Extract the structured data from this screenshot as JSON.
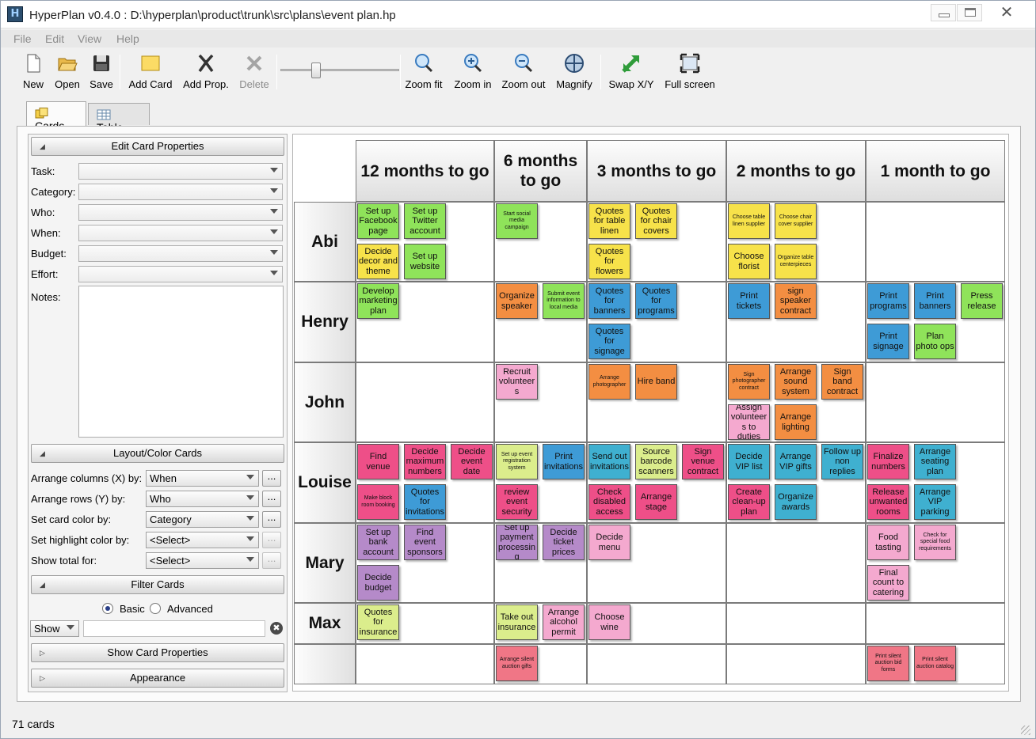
{
  "window": {
    "title": "HyperPlan v0.4.0 : D:\\hyperplan\\product\\trunk\\src\\plans\\event plan.hp"
  },
  "menu": [
    "File",
    "Edit",
    "View",
    "Help"
  ],
  "toolbar": {
    "new": "New",
    "open": "Open",
    "save": "Save",
    "add_card": "Add Card",
    "add_prop": "Add Prop.",
    "delete": "Delete",
    "zoom_fit": "Zoom fit",
    "zoom_in": "Zoom in",
    "zoom_out": "Zoom out",
    "magnify": "Magnify",
    "swap": "Swap X/Y",
    "full_screen": "Full screen"
  },
  "tabs": {
    "cards": "Cards",
    "table": "Table"
  },
  "edit_panel": {
    "header": "Edit Card Properties",
    "task": "Task:",
    "category": "Category:",
    "who": "Who:",
    "when": "When:",
    "budget": "Budget:",
    "effort": "Effort:",
    "notes": "Notes:"
  },
  "layout_panel": {
    "header": "Layout/Color Cards",
    "arrange_x_label": "Arrange columns (X) by:",
    "arrange_x_value": "When",
    "arrange_y_label": "Arrange rows (Y) by:",
    "arrange_y_value": "Who",
    "card_color_label": "Set card color by:",
    "card_color_value": "Category",
    "highlight_label": "Set highlight color by:",
    "highlight_value": "<Select>",
    "total_label": "Show total for:",
    "total_value": "<Select>",
    "dots": "..."
  },
  "filter_panel": {
    "header": "Filter Cards",
    "basic": "Basic",
    "advanced": "Advanced",
    "show": "Show",
    "clear": "✖"
  },
  "show_props_header": "Show Card Properties",
  "appearance_header": "Appearance",
  "grid": {
    "columns": [
      "12 months to go",
      "6 months to go",
      "3 months to go",
      "2 months to go",
      "1 month to go"
    ],
    "rows": [
      "Abi",
      "Henry",
      "John",
      "Louise",
      "Mary",
      "Max",
      ""
    ]
  },
  "colors": {
    "green": "#8fe35a",
    "yellow": "#f7e24a",
    "orange": "#f38e42",
    "blue": "#3e9bd6",
    "pink": "#ee4f88",
    "lightpink": "#f4a9cf",
    "purple": "#b58ac9",
    "lime": "#dbed8c",
    "teal": "#3fb0d0",
    "rose": "#f07686"
  },
  "cards": [
    {
      "t": "Set up Facebook page",
      "c": "green",
      "col": 0,
      "row": 0,
      "s": 0
    },
    {
      "t": "Set up Twitter account",
      "c": "green",
      "col": 0,
      "row": 0,
      "s": 1
    },
    {
      "t": "Decide decor and theme",
      "c": "yellow",
      "col": 0,
      "row": 0,
      "s": 3
    },
    {
      "t": "Set up website",
      "c": "green",
      "col": 0,
      "row": 0,
      "s": 4
    },
    {
      "t": "Start social media campaign",
      "c": "green",
      "col": 1,
      "row": 0,
      "s": 0,
      "sm": true
    },
    {
      "t": "Quotes for table linen",
      "c": "yellow",
      "col": 2,
      "row": 0,
      "s": 0
    },
    {
      "t": "Quotes for chair covers",
      "c": "yellow",
      "col": 2,
      "row": 0,
      "s": 1
    },
    {
      "t": "Quotes for flowers",
      "c": "yellow",
      "col": 2,
      "row": 0,
      "s": 3
    },
    {
      "t": "Choose table linen supplier",
      "c": "yellow",
      "col": 3,
      "row": 0,
      "s": 0,
      "sm": true
    },
    {
      "t": "Choose chair cover supplier",
      "c": "yellow",
      "col": 3,
      "row": 0,
      "s": 1,
      "sm": true
    },
    {
      "t": "Choose florist",
      "c": "yellow",
      "col": 3,
      "row": 0,
      "s": 3
    },
    {
      "t": "Organize table centerpieces",
      "c": "yellow",
      "col": 3,
      "row": 0,
      "s": 4,
      "sm": true
    },
    {
      "t": "Develop marketing plan",
      "c": "green",
      "col": 0,
      "row": 1,
      "s": 0
    },
    {
      "t": "Organize speaker",
      "c": "orange",
      "col": 1,
      "row": 1,
      "s": 0
    },
    {
      "t": "Submit event information to local media",
      "c": "green",
      "col": 1,
      "row": 1,
      "s": 1,
      "sm": true
    },
    {
      "t": "Quotes for banners",
      "c": "blue",
      "col": 2,
      "row": 1,
      "s": 0
    },
    {
      "t": "Quotes for programs",
      "c": "blue",
      "col": 2,
      "row": 1,
      "s": 1
    },
    {
      "t": "Quotes for signage",
      "c": "blue",
      "col": 2,
      "row": 1,
      "s": 3
    },
    {
      "t": "Print tickets",
      "c": "blue",
      "col": 3,
      "row": 1,
      "s": 0
    },
    {
      "t": "sign speaker contract",
      "c": "orange",
      "col": 3,
      "row": 1,
      "s": 1
    },
    {
      "t": "Print programs",
      "c": "blue",
      "col": 4,
      "row": 1,
      "s": 0
    },
    {
      "t": "Print banners",
      "c": "blue",
      "col": 4,
      "row": 1,
      "s": 1
    },
    {
      "t": "Press release",
      "c": "green",
      "col": 4,
      "row": 1,
      "s": 2
    },
    {
      "t": "Print signage",
      "c": "blue",
      "col": 4,
      "row": 1,
      "s": 3
    },
    {
      "t": "Plan photo ops",
      "c": "green",
      "col": 4,
      "row": 1,
      "s": 4
    },
    {
      "t": "Recruit volunteers",
      "c": "lightpink",
      "col": 1,
      "row": 2,
      "s": 0
    },
    {
      "t": "Arrange photographer",
      "c": "orange",
      "col": 2,
      "row": 2,
      "s": 0,
      "sm": true
    },
    {
      "t": "Hire band",
      "c": "orange",
      "col": 2,
      "row": 2,
      "s": 1
    },
    {
      "t": "Sign photographer contract",
      "c": "orange",
      "col": 3,
      "row": 2,
      "s": 0,
      "sm": true
    },
    {
      "t": "Arrange sound system",
      "c": "orange",
      "col": 3,
      "row": 2,
      "s": 1
    },
    {
      "t": "Sign band contract",
      "c": "orange",
      "col": 3,
      "row": 2,
      "s": 2
    },
    {
      "t": "Assign volunteers to duties",
      "c": "lightpink",
      "col": 3,
      "row": 2,
      "s": 3
    },
    {
      "t": "Arrange lighting",
      "c": "orange",
      "col": 3,
      "row": 2,
      "s": 4
    },
    {
      "t": "Find venue",
      "c": "pink",
      "col": 0,
      "row": 3,
      "s": 0
    },
    {
      "t": "Decide maximum numbers",
      "c": "pink",
      "col": 0,
      "row": 3,
      "s": 1
    },
    {
      "t": "Decide event date",
      "c": "pink",
      "col": 0,
      "row": 3,
      "s": 2
    },
    {
      "t": "Make block room booking",
      "c": "pink",
      "col": 0,
      "row": 3,
      "s": 3,
      "sm": true
    },
    {
      "t": "Quotes for invitations",
      "c": "blue",
      "col": 0,
      "row": 3,
      "s": 4
    },
    {
      "t": "Set up event registration system",
      "c": "lime",
      "col": 1,
      "row": 3,
      "s": 0,
      "sm": true
    },
    {
      "t": "Print invitations",
      "c": "blue",
      "col": 1,
      "row": 3,
      "s": 1
    },
    {
      "t": "review event security",
      "c": "pink",
      "col": 1,
      "row": 3,
      "s": 3
    },
    {
      "t": "Send out invitations",
      "c": "teal",
      "col": 2,
      "row": 3,
      "s": 0
    },
    {
      "t": "Source barcode scanners",
      "c": "lime",
      "col": 2,
      "row": 3,
      "s": 1
    },
    {
      "t": "Sign venue contract",
      "c": "pink",
      "col": 2,
      "row": 3,
      "s": 2
    },
    {
      "t": "Check disabled access",
      "c": "pink",
      "col": 2,
      "row": 3,
      "s": 3
    },
    {
      "t": "Arrange stage",
      "c": "pink",
      "col": 2,
      "row": 3,
      "s": 4
    },
    {
      "t": "Decide VIP list",
      "c": "teal",
      "col": 3,
      "row": 3,
      "s": 0
    },
    {
      "t": "Arrange VIP gifts",
      "c": "teal",
      "col": 3,
      "row": 3,
      "s": 1
    },
    {
      "t": "Follow up non replies",
      "c": "teal",
      "col": 3,
      "row": 3,
      "s": 2
    },
    {
      "t": "Create clean-up plan",
      "c": "pink",
      "col": 3,
      "row": 3,
      "s": 3
    },
    {
      "t": "Organize awards",
      "c": "teal",
      "col": 3,
      "row": 3,
      "s": 4
    },
    {
      "t": "Finalize numbers",
      "c": "pink",
      "col": 4,
      "row": 3,
      "s": 0
    },
    {
      "t": "Arrange seating plan",
      "c": "teal",
      "col": 4,
      "row": 3,
      "s": 1
    },
    {
      "t": "Release unwanted rooms",
      "c": "pink",
      "col": 4,
      "row": 3,
      "s": 3
    },
    {
      "t": "Arrange VIP parking",
      "c": "teal",
      "col": 4,
      "row": 3,
      "s": 4
    },
    {
      "t": "Set up bank account",
      "c": "purple",
      "col": 0,
      "row": 4,
      "s": 0
    },
    {
      "t": "Find event sponsors",
      "c": "purple",
      "col": 0,
      "row": 4,
      "s": 1
    },
    {
      "t": "Decide budget",
      "c": "purple",
      "col": 0,
      "row": 4,
      "s": 3
    },
    {
      "t": "Set up payment processing",
      "c": "purple",
      "col": 1,
      "row": 4,
      "s": 0
    },
    {
      "t": "Decide ticket prices",
      "c": "purple",
      "col": 1,
      "row": 4,
      "s": 1
    },
    {
      "t": "Decide menu",
      "c": "lightpink",
      "col": 2,
      "row": 4,
      "s": 0
    },
    {
      "t": "Food tasting",
      "c": "lightpink",
      "col": 4,
      "row": 4,
      "s": 0
    },
    {
      "t": "Check for special food requirements",
      "c": "lightpink",
      "col": 4,
      "row": 4,
      "s": 1,
      "sm": true
    },
    {
      "t": "Final count to catering",
      "c": "lightpink",
      "col": 4,
      "row": 4,
      "s": 3
    },
    {
      "t": "Quotes for insurance",
      "c": "lime",
      "col": 0,
      "row": 5,
      "s": 0
    },
    {
      "t": "Take out insurance",
      "c": "lime",
      "col": 1,
      "row": 5,
      "s": 0
    },
    {
      "t": "Arrange alcohol permit",
      "c": "lightpink",
      "col": 1,
      "row": 5,
      "s": 1
    },
    {
      "t": "Choose wine",
      "c": "lightpink",
      "col": 2,
      "row": 5,
      "s": 0
    },
    {
      "t": "Arrange silent auction gifts",
      "c": "rose",
      "col": 1,
      "row": 6,
      "s": 0,
      "sm": true
    },
    {
      "t": "Print silent auction bid forms",
      "c": "rose",
      "col": 4,
      "row": 6,
      "s": 0,
      "sm": true
    },
    {
      "t": "Print silent auction catalog",
      "c": "rose",
      "col": 4,
      "row": 6,
      "s": 1,
      "sm": true
    }
  ],
  "status": "71 cards"
}
